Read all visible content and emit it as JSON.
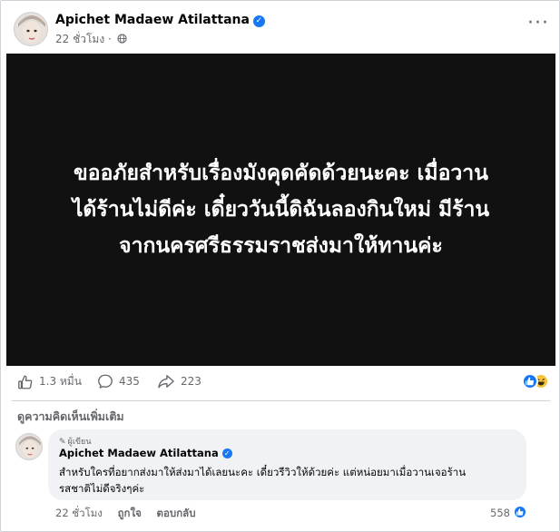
{
  "post": {
    "author": "Apichet Madaew Atilattana",
    "time": "22 ชั่วโมง",
    "image_text": "ขออภัยสำหรับเรื่องมังคุดคัดด้วยนะคะ เมื่อวาน\nได้ร้านไม่ดีค่ะ เดี๋ยววันนี้ดิฉันลองกินใหม่ มีร้าน\nจากนครศรีธรรมราชส่งมาให้ทานค่ะ"
  },
  "stats": {
    "likes": "1.3 หมื่น",
    "comments": "435",
    "shares": "223"
  },
  "more_comments_label": "ดูความคิดเห็นเพิ่มเติม",
  "comment": {
    "badge": "ผู้เขียน",
    "author": "Apichet Madaew Atilattana",
    "text": "สำหรับใครที่อยากส่งมาให้ส่งมาได้เลยนะคะ เดี๋ยวรีวิวให้ด้วยค่ะ แต่หน่อยมาเมื่อวานเจอร้าน\nรสชาติไม่ดีจริงๆค่ะ",
    "time": "22 ชั่วโมง",
    "like_label": "ถูกใจ",
    "reply_label": "ตอบกลับ",
    "reaction_count": "558"
  },
  "colors": {
    "verified": "#1877f2",
    "like_reaction": "#1877f2",
    "haha_reaction": "#f7c33c",
    "secondary_text": "#65676b"
  },
  "icons": [
    "globe-icon",
    "more-options-icon",
    "like-icon",
    "comment-icon",
    "share-icon",
    "like-reaction-icon",
    "haha-reaction-icon",
    "pencil-icon",
    "verified-badge-icon"
  ]
}
